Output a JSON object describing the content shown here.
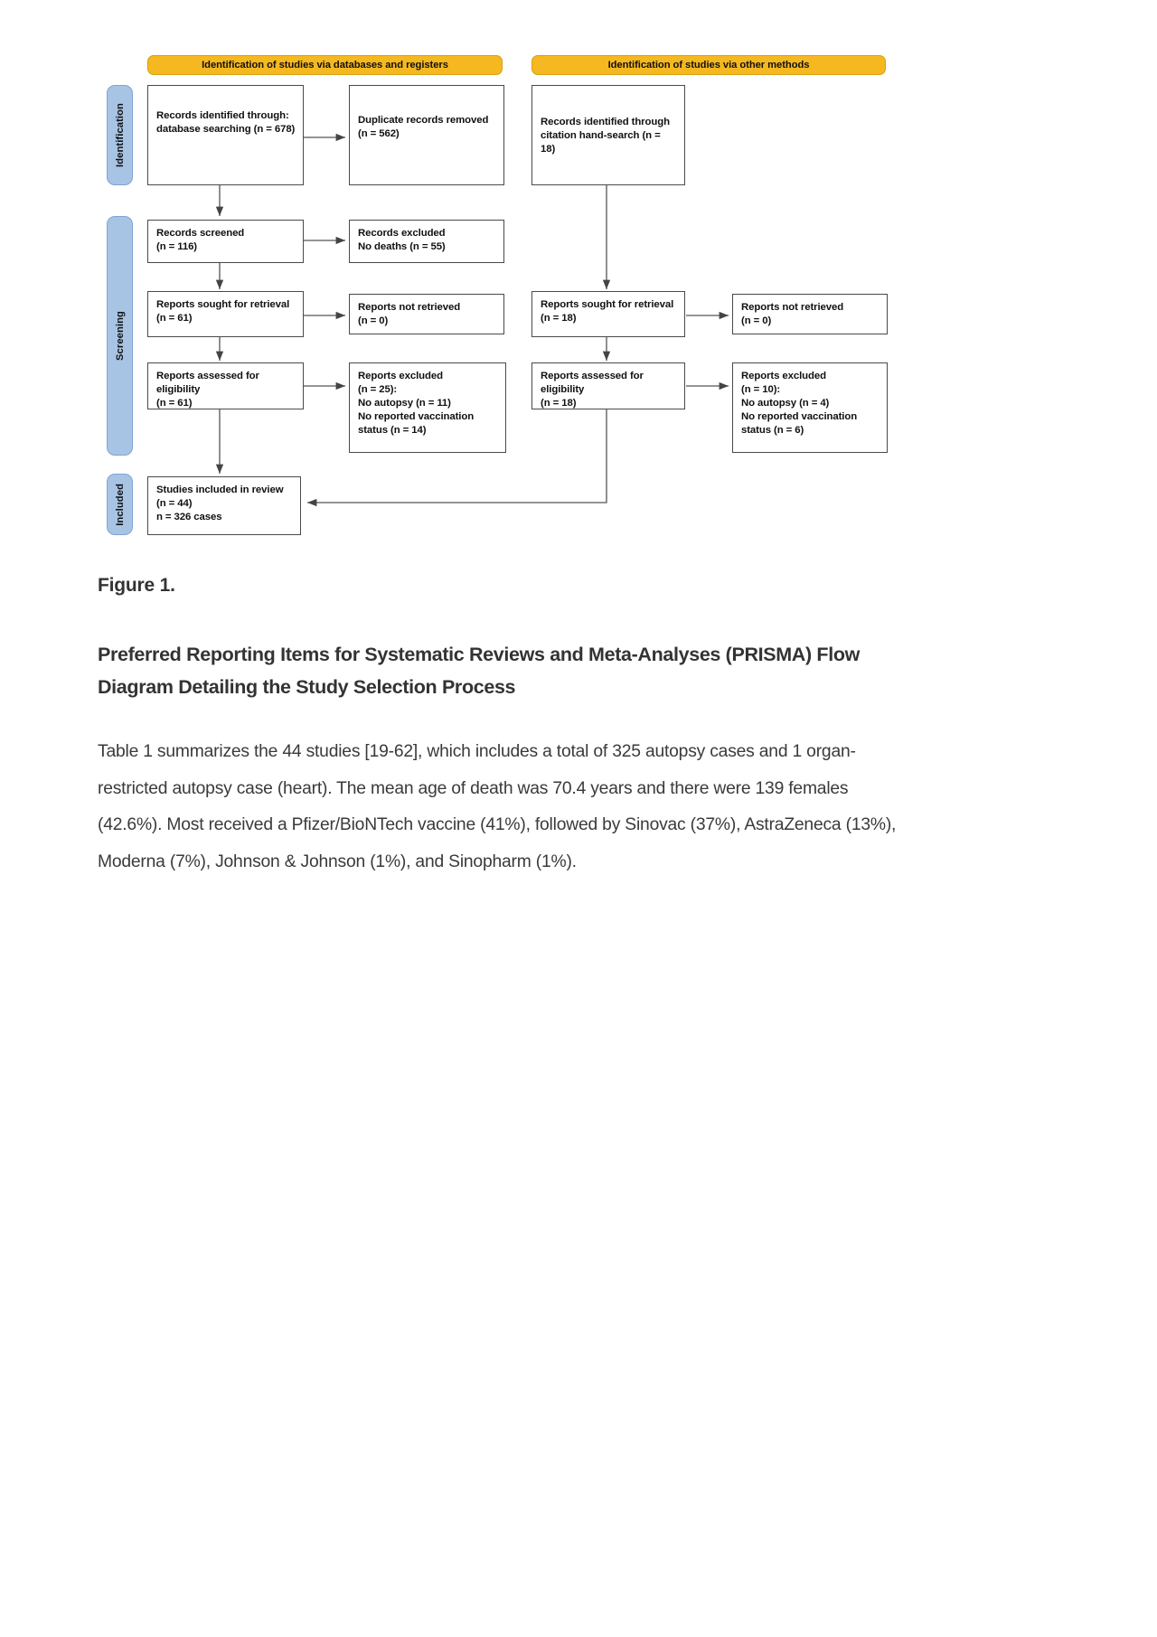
{
  "figure": {
    "label": "Figure 1.",
    "title": "Preferred Reporting Items for Systematic Reviews and Meta-Analyses (PRISMA) Flow Diagram Detailing the Study Selection Process"
  },
  "diagram": {
    "headers": {
      "left": "Identification of studies via databases and registers",
      "right": "Identification of studies via other methods"
    },
    "stages": {
      "identification": "Identification",
      "screening": "Screening",
      "included": "Included"
    },
    "left_column": {
      "records_identified": "Records identified through: database searching (n = 678)",
      "duplicates_removed": "Duplicate records removed (n = 562)",
      "records_screened": "Records screened\n(n = 116)",
      "records_excluded": "Records excluded\nNo deaths (n = 55)",
      "reports_sought": "Reports sought for retrieval\n(n = 61)",
      "reports_not_retrieved": "Reports not retrieved\n(n = 0)",
      "reports_assessed": "Reports assessed for eligibility\n(n = 61)",
      "reports_excluded": "Reports excluded\n(n = 25):\nNo autopsy (n = 11)\nNo reported vaccination status (n = 14)"
    },
    "right_column": {
      "records_identified": "Records identified through citation hand-search (n = 18)",
      "reports_sought": "Reports sought for retrieval\n(n = 18)",
      "reports_not_retrieved": "Reports not retrieved\n(n = 0)",
      "reports_assessed": "Reports assessed for eligibility\n(n = 18)",
      "reports_excluded": "Reports excluded\n(n = 10):\nNo autopsy (n = 4)\nNo reported vaccination status (n = 6)"
    },
    "included_box": "Studies included in review\n(n = 44)\nn = 326 cases",
    "colors": {
      "header_fill": "#f5b820",
      "stage_fill": "#a8c4e5",
      "box_border": "#4a4a4a",
      "arrow": "#555555"
    }
  },
  "body": {
    "paragraph": "Table 1 summarizes the 44 studies [19-62], which includes a total of 325 autopsy cases and 1 organ-restricted autopsy case (heart). The mean age of death was 70.4 years and there were 139 females (42.6%). Most received a Pfizer/BioNTech vaccine (41%), followed by Sinovac (37%), AstraZeneca (13%), Moderna (7%), Johnson & Johnson (1%), and Sinopharm (1%)."
  }
}
